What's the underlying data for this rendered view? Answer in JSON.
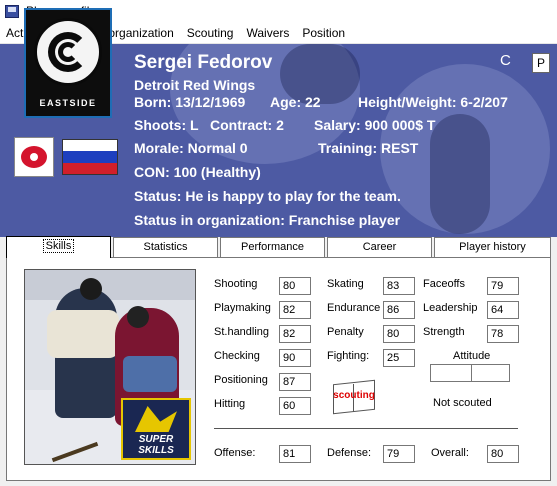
{
  "window": {
    "title": "Player profile"
  },
  "menu": [
    "Actions",
    "Status in organization",
    "Scouting",
    "Waivers",
    "Position"
  ],
  "player": {
    "name": "Sergei Fedorov",
    "team": "Detroit Red Wings",
    "born": "Born: 13/12/1969",
    "age": "Age: 22",
    "height_weight": "Height/Weight: 6-2/207",
    "shoots": "Shoots: L",
    "contract": "Contract: 2",
    "salary": "Salary: 900 000$ T",
    "morale": "Morale: Normal 0",
    "training": "Training: REST",
    "con": "CON: 100 (Healthy)",
    "status": "Status: He is happy to play for the team.",
    "org_status": "Status in organization: Franchise player",
    "team_logo_text": "EASTSIDE"
  },
  "header_buttons": {
    "c": "C",
    "p": "P"
  },
  "flag_colors": [
    "#ffffff",
    "#1d3fbf",
    "#d11f2a"
  ],
  "tabs": [
    "Skills",
    "Statistics",
    "Performance",
    "Career",
    "Player history"
  ],
  "skills": {
    "shooting": {
      "label": "Shooting",
      "value": "80"
    },
    "playmaking": {
      "label": "Playmaking",
      "value": "82"
    },
    "sthandling": {
      "label": "St.handling",
      "value": "82"
    },
    "checking": {
      "label": "Checking",
      "value": "90"
    },
    "positioning": {
      "label": "Positioning",
      "value": "87"
    },
    "hitting": {
      "label": "Hitting",
      "value": "60"
    },
    "skating": {
      "label": "Skating",
      "value": "83"
    },
    "endurance": {
      "label": "Endurance",
      "value": "86"
    },
    "penalty": {
      "label": "Penalty",
      "value": "80"
    },
    "fighting": {
      "label": "Fighting:",
      "value": "25"
    },
    "faceoffs": {
      "label": "Faceoffs",
      "value": "79"
    },
    "leadership": {
      "label": "Leadership",
      "value": "64"
    },
    "strength": {
      "label": "Strength",
      "value": "78"
    },
    "attitude_label": "Attitude",
    "not_scouted": "Not scouted",
    "scouting_button": "scouting",
    "badge_text": "SUPER SKILLS"
  },
  "ratings": {
    "offense": {
      "label": "Offense:",
      "value": "81"
    },
    "defense": {
      "label": "Defense:",
      "value": "79"
    },
    "overall": {
      "label": "Overall:",
      "value": "80"
    }
  }
}
